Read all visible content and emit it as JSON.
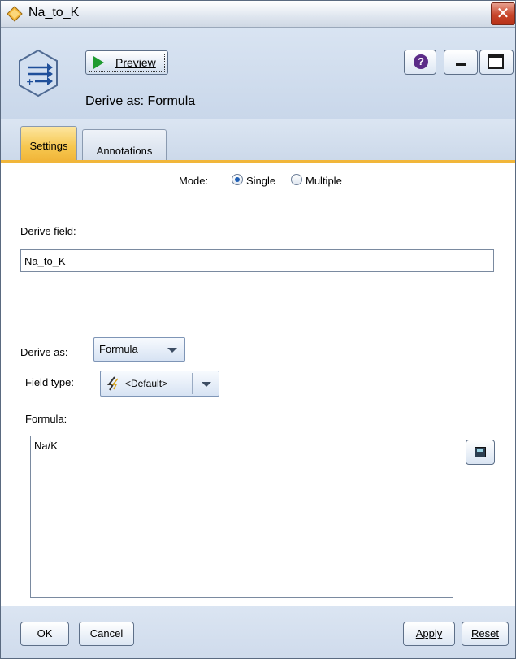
{
  "window": {
    "title": "Na_to_K",
    "close_label": "✕"
  },
  "header": {
    "preview_label": "Preview",
    "help_label": "?",
    "derive_heading": "Derive as: Formula"
  },
  "tabs": [
    {
      "label": "Settings",
      "active": true
    },
    {
      "label": "Annotations",
      "active": false
    }
  ],
  "settings": {
    "mode_label": "Mode:",
    "mode_options": [
      "Single",
      "Multiple"
    ],
    "mode_selected": "Single",
    "derive_field_label": "Derive field:",
    "derive_field_value": "Na_to_K",
    "derive_as_label": "Derive as:",
    "derive_as_value": "Formula",
    "field_type_label": "Field type:",
    "field_type_value": "<Default>",
    "formula_label": "Formula:",
    "formula_value": "Na/K"
  },
  "footer": {
    "ok_label": "OK",
    "cancel_label": "Cancel",
    "apply_label": "Apply",
    "reset_label": "Reset"
  },
  "colors": {
    "active_tab": "#f6c750",
    "header_bg": "#d9e4f2",
    "close_button": "#c7452a"
  }
}
